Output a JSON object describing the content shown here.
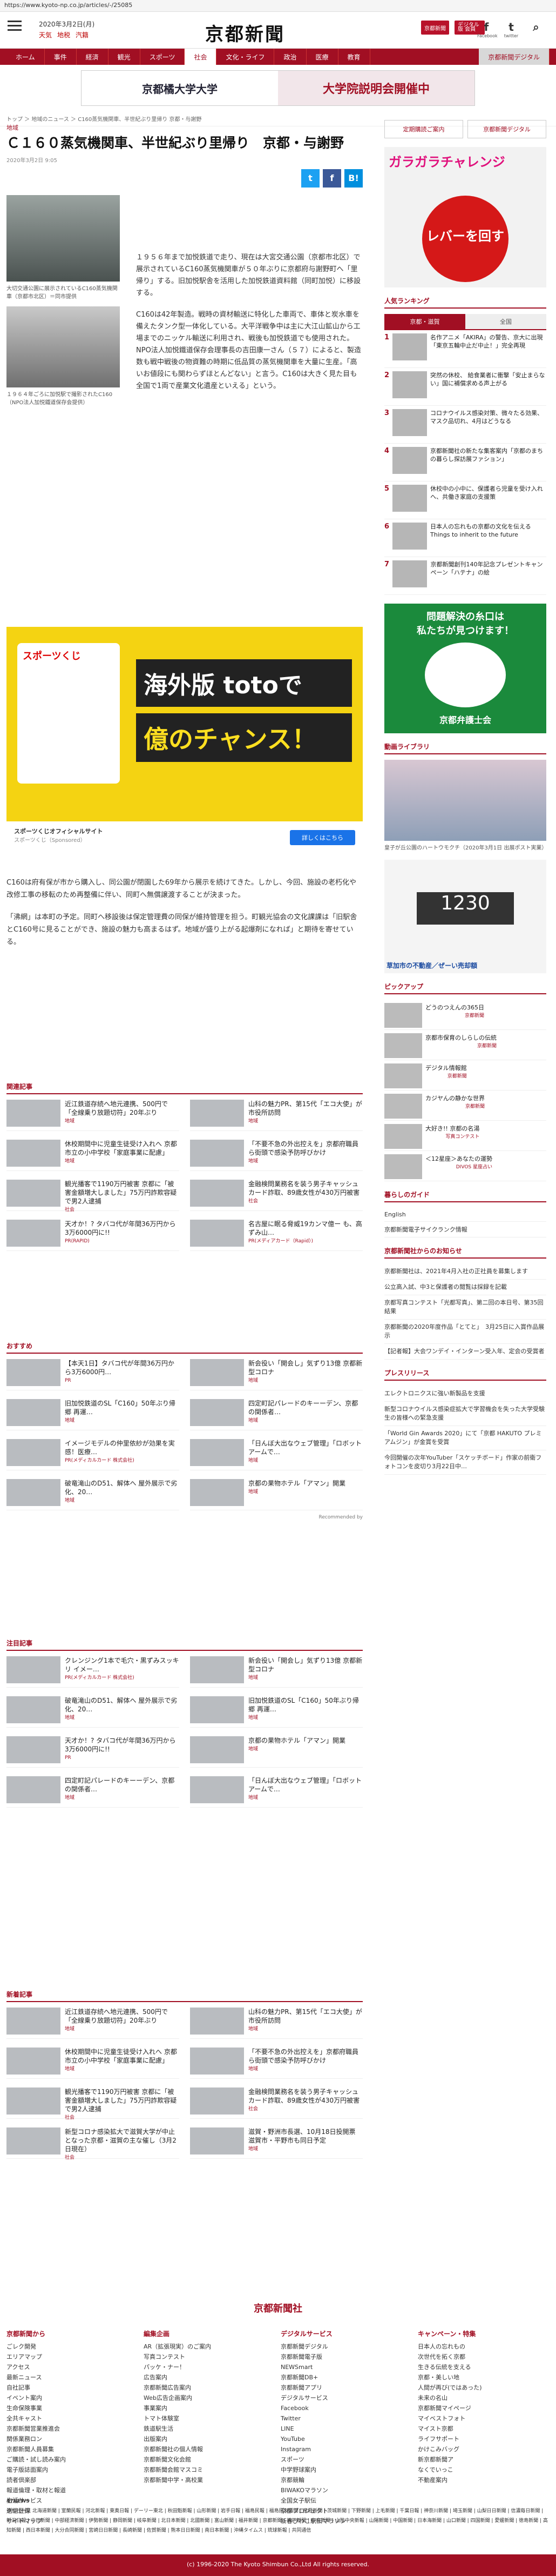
{
  "browser": {
    "url": "https://www.kyoto-np.co.jp/articles/-/25085"
  },
  "header": {
    "date": "2020年3月2日(月)",
    "weather": [
      "天気",
      "地税",
      "汽籍"
    ],
    "logo": "京都新聞",
    "btn_member": "京都新聞",
    "btn_digital": "デジタル版 会員",
    "social": [
      "Facebook",
      "twitter",
      "B!"
    ]
  },
  "nav": [
    "ホーム",
    "事件",
    "経済",
    "観光",
    "スポーツ",
    "社会",
    "文化・ライフ",
    "政治",
    "医療",
    "教育",
    "京都新聞デジタル"
  ],
  "banner": {
    "left": "京都橘大学大学",
    "right": "大学院説明会開催中"
  },
  "breadcrumb": "トップ ＞ 地域のニュース ＞ C160蒸気機関車、半世紀ぶり里帰り 京都・与謝野",
  "article": {
    "category": "地域",
    "title": "Ｃ１６０蒸気機関車、半世紀ぶり里帰り　京都・与謝野",
    "date": "2020年3月2日 9:05",
    "caption1": "大切交通公園に展示されているC160蒸気機関車（京都市北区）＝同市提供",
    "caption2": "１９６４年ごろに加悦駅で撮影されたC160（NPO法人加悦鐵道保存会提供）",
    "p1": "１９５６年まで加悦鉄道で走り、現在は大宮交通公園（京都市北区）で展示されているC160蒸気機関車が５０年ぶりに京都府与謝野町へ「里帰り」する。旧加悦駅舎を活用した加悦鉄道資料館（同町加悦）に移設する。",
    "p2": "C160は42年製造。戦時の資材輸送に特化した車両で、車体と炭水車を備えたタンク型一体化している。大平洋戦争中は主に大江山鉱山から工場までのニッケル輸送に利用され、戦後も加悦鉄道でも使用された。NPO法人加悦鐵道保存会理事長の吉田康一さん（５７）によると、製造数も戦中戦後の物資難の時期に低品質の蒸気機関車を大量に生産。「高いお値段にも関わらずほとんどない」と言う。C160は大きく見た目も全国で1両で産業文化遺産といえる」という。",
    "p3": "C160は府有保が市から購入し、同公園が閉園した69年から展示を続けてきた。しかし、今回、施設の老朽化や改修工事の移転のため再整備に伴い、同町へ無償譲渡することが決まった。",
    "p4": "「沸網」は本町の予定。同町へ移設後は保定管理費の同保が維持管理を担う。町観光協会の文化課課は「旧駅舎とC160号に見ることができ、施設の魅力も高まるはず。地域が盛り上がる起爆剤になれば」と期待を寄せている。"
  },
  "ad": {
    "brand": "スポーツくじ",
    "line1": "海外版 totoで",
    "line2": "億のチャンス！",
    "site": "スポーツくじオフィシャルサイト",
    "sponsor": "スポーツくじ（Sponsored）",
    "cta": "詳しくはこちら"
  },
  "related": {
    "title": "関連記事",
    "items": [
      {
        "t": "近江鉄道存続へ地元連携、500円で「全線乗り放題切符」20年ぶり",
        "tag": "地域"
      },
      {
        "t": "山科の魅力PR、第15代「エコ大使」が市役所訪問",
        "tag": "地域"
      },
      {
        "t": "休校期間中に児童生徒受け入れへ 京都市立の小中学校「家庭事業に配慮」",
        "tag": "地域"
      },
      {
        "t": "「不要不急の外出控えを」京都府職員ら街頭で感染予防呼びかけ",
        "tag": "地域"
      },
      {
        "t": "観光播客で1190万円被害 京都に「被害金額増大しました」75万円詐欺容疑で男2人逮捕",
        "tag": "社会"
      },
      {
        "t": "金融検問業務名を装う男子キャッシュカード詐取、89歳女性が430万円被害",
        "tag": "社会"
      },
      {
        "t": "天才か！? タバコ代が年間36万円から3万6000円に!!",
        "tag": "PR(RAPID)"
      },
      {
        "t": "名古屋に眠る脅威19カンマ億ー も、高ずみ山…",
        "tag": "PR(メディアカード（Rapid）)"
      }
    ]
  },
  "recommend": {
    "title": "おすすめ",
    "items": [
      {
        "t": "【本天1日】タバコ代が年間36万円から3万6000円…",
        "tag": "PR"
      },
      {
        "t": "新会役い「開会し」気ずり13億 京都新型コロナ",
        "tag": "地域"
      },
      {
        "t": "旧加悦鉄道のSL「C160」50年ぶり帰郷 再運…",
        "tag": "地域"
      },
      {
        "t": "四定町記パレードのキーーデン、京都の関係者…",
        "tag": "地域"
      },
      {
        "t": "イメージモデルの仲里依紗が効果を実感！医療…",
        "tag": "PR(メディカルカード 株式会社)"
      },
      {
        "t": "「日んぼ大出なウェブ管理」「ロボットアームで…",
        "tag": "地域"
      },
      {
        "t": "破竜滝山のD51、解体へ 屋外展示で劣化、20…",
        "tag": "地域"
      },
      {
        "t": "京都の果物ホテル「アマン」開業",
        "tag": "地域"
      }
    ],
    "footer": "Recommended by"
  },
  "attention": {
    "title": "注目記事",
    "items": [
      {
        "t": "クレンジング1本で毛穴・黒ずみスッキリ イメー…",
        "tag": "PR(メディカルカード 株式会社)"
      },
      {
        "t": "新会役い「開会し」気ずり13億 京都新型コロナ",
        "tag": "地域"
      },
      {
        "t": "破竜滝山のD51、解体へ 屋外展示で劣化、20…",
        "tag": "地域"
      },
      {
        "t": "旧加悦鉄道のSL「C160」50年ぶり帰郷 再運…",
        "tag": "地域"
      },
      {
        "t": "天才か！? タバコ代が年間36万円から3万6000円に!!",
        "tag": "PR"
      },
      {
        "t": "京都の果物ホテル「アマン」開業",
        "tag": "地域"
      },
      {
        "t": "四定町記パレードのキーーデン、京都の関係者…",
        "tag": "地域"
      },
      {
        "t": "「日んぼ大出なウェブ管理」「ロボットアームで…",
        "tag": "地域"
      }
    ]
  },
  "latest": {
    "title": "新着記事",
    "items": [
      {
        "t": "近江鉄道存続へ地元連携、500円で「全線乗り放題切符」20年ぶり",
        "tag": "地域"
      },
      {
        "t": "山科の魅力PR、第15代「エコ大使」が市役所訪問",
        "tag": "地域"
      },
      {
        "t": "休校期間中に児童生徒受け入れへ 京都市立の小中学校「家庭事業に配慮」",
        "tag": "地域"
      },
      {
        "t": "「不要不急の外出控えを」京都府職員ら街頭で感染予防呼びかけ",
        "tag": "地域"
      },
      {
        "t": "観光播客で1190万円被害 京都に「被害金額増大しました」75万円詐欺容疑で男2人逮捕",
        "tag": "社会"
      },
      {
        "t": "金融検問業務名を装う男子キャッシュカード詐取、89歳女性が430万円被害",
        "tag": "社会"
      },
      {
        "t": "新型コロナ感染拡大で滋賀大学が中止となった京都・滋賀の主な催し（3月2日現在）",
        "tag": "社会"
      },
      {
        "t": "滋賀・野洲市長選、10月18日投開票 滋賀市・平野市も同日予定",
        "tag": "地域"
      }
    ]
  },
  "sidebar": {
    "btn_left": "定期購読ご案内",
    "btn_right": "京都新聞デジタル",
    "ad_title": "ガラガラチャレンジ",
    "ad_button": "レバーを回す",
    "rank_title": "人気ランキング",
    "rank_tabs": [
      "京都・滋賀",
      "全国"
    ],
    "ranking": [
      {
        "n": "1",
        "t": "名作アニメ「AKIRA」の警告、京大に出現「東京五輪中止だ中止！」完全再現"
      },
      {
        "n": "2",
        "t": "突然の休校、 給食業者に衝撃「安止まらない」国に補償求める声上がる"
      },
      {
        "n": "3",
        "t": "コロナウイルス感染対策、微々たる効果、マスク品切れ、4月はどうなる"
      },
      {
        "n": "4",
        "t": "京都新聞社の新たな集客案内「京都のまちの暮らし探訪展ファション」"
      },
      {
        "n": "5",
        "t": "休校中の小中に、保護者ら児童を受け入れへ、共働き家庭の支援策"
      },
      {
        "n": "6",
        "t": "日本人の忘れもの京都の文化を伝える Things to inherit to the future"
      },
      {
        "n": "7",
        "t": "京都新聞創刊140年記念プレゼントキャンペーン「ハテナ」の絵"
      }
    ],
    "green_ad_a": "問題解決の糸口は",
    "green_ad_a2": "私たちが見つけます！",
    "green_ad_b": "京都弁護士会",
    "video_title": "動画ライブラリ",
    "video_caption": "皇子が丘公園のハートウモクチ（2020年3月1日 出展ポスト実業）",
    "house_ad": "草加市の不動産／ぜーい売却額",
    "pickup_title": "ピックアップ",
    "pickup": [
      "どうのつえんの365日",
      "京都市保育のしらしの伝統",
      "デジタル情報館",
      "カジヤんの静かな世界",
      "大好き!! 京都の名湯",
      "＜12星座＞あなたの運勢"
    ],
    "pickup_tags": [
      "京都新聞",
      "京都新聞",
      "京都新聞",
      "京都新聞",
      "写真コンテスト",
      "DIVOS 星座占い"
    ],
    "life_title": "暮らしのガイド",
    "life": [
      "English",
      "京都新聞電子サイクランク情報"
    ],
    "notice_title": "京都新聞社からのお知らせ",
    "notices": [
      "京都新聞社は、2021年4月入社の正社員を募集します",
      "公立高入試、中3と保護者の閲覧は採録を記載",
      "京都写真コンテスト「光都写真」、第二回の本日号、第35回結果",
      "京都新聞の2020年度作品「とてと」　3月25日に入賞作品展示",
      "【記者報】大会ワンデイ・インターン受入年、定会の受賞者"
    ],
    "press_title": "プレスリリース",
    "press": [
      "エレクトロニクスに強い新製品を支援",
      "新型コロナウイルス感染症拡大で学習機会を失った大学受験生の皆様への緊急支援",
      "「World Gin Awards 2020」にて「京都 HAKUTO プレミアムジン」が金賞を受賞",
      "今回開催の次年YouTuber「スケッチボード」作家の前衛フォトコンを皮切り3月22日中…"
    ]
  },
  "footer": {
    "logo": "京都新聞社",
    "cols": [
      {
        "h": "京都新聞から",
        "items": [
          "ごレク開発",
          "エリアマップ",
          "アクセス",
          "最新ニュース",
          "自社記事",
          "イベント案内",
          "生命保険事業",
          "全共キャスト",
          "京都新聞営業推進会",
          "関係業務ロン",
          "京都新聞人員募集",
          "ご購読・試し読み案内",
          "電子版誌面案内",
          "読者倶楽部",
          "報道倫理・取材と報道",
          "生活サービス",
          "送信登録",
          "サイトマップ"
        ]
      },
      {
        "h": "編集企画",
        "items": [
          "AR（拡張現実）のご案内",
          "写真コンテスト",
          "パッケ・ナー！",
          "広告案内",
          "京都新聞広告案内",
          "Web広告企画案内",
          "事業案内",
          "トマト体験室",
          "鉄道駅生活",
          "出版案内",
          "京都新聞社の個人情報",
          "京都新聞文化会館",
          "京都新聞会館マスコミ",
          "京都新聞中学・高校業"
        ]
      },
      {
        "h": "デジタルサービス",
        "items": [
          "京都新聞デジタル",
          "京都新聞電子版",
          "NEWSmart",
          "京都新聞DB+",
          "京都新聞アプリ",
          "デジタルサービス",
          "Facebook",
          "Twitter",
          "LINE",
          "YouTube",
          "Instagram",
          "スポーツ",
          "中学野球案内",
          "京都競輪",
          "BIWAKOマラソン",
          "全国女子駅伝",
          "京都プロジェクト",
          "新春ぴわこ駅伝マラソン"
        ]
      },
      {
        "h": "キャンペーン・特集",
        "items": [
          "日本人の忘れもの",
          "次世代を拓く京都",
          "生きる伝統を支える",
          "京都・美しい地",
          "人間が再び(ではあった)",
          "未来の名山",
          "京都新聞マイページ",
          "マイベストフォト",
          "マイスト京都",
          "ライフサポート",
          "かけこみバッグ",
          "新京都新聞ア",
          "なくでいっこ",
          "不動産案内"
        ]
      }
    ],
    "news47_label": "47NEWS",
    "news47": "参加社一覧 北海道新聞 | 室蘭民報 | 河北新報 | 東奥日報 | デーリー東北 | 秋田魁新報 | 山形新聞 | 岩手日報 | 福島民報 | 福島民友新聞 | 産経新聞 | 茨城新聞 | 下野新聞 | 上毛新聞 | 千葉日報 | 神奈川新聞 | 埼玉新聞 | 山梨日日新聞 | 信濃毎日新聞 | 新潟日報 | 中日新聞 | 中部経済新聞 | 伊勢新聞 | 静岡新聞 | 岐阜新聞 | 北日本新聞 | 北國新聞 | 富山新聞 | 福井新聞 | 京都新聞 | 神戸新聞 | 奈良新聞 | 山陰中央新報 | 山陽新聞 | 中国新聞 | 日本海新聞 | 山口新聞 | 四国新聞 | 愛媛新聞 | 徳島新聞 | 高知新聞 | 西日本新聞 | 大分合同新聞 | 宮崎日日新聞 | 長崎新聞 | 佐賀新聞 | 熊本日日新聞 | 南日本新聞 | 沖縄タイムス | 琉球新報 | 共同通信",
    "copyright": "(c) 1996-2020 The Kyoto Shimbun Co.,Ltd All rights reserved."
  },
  "colors": {
    "brand": "#a10f23",
    "twitter": "#1da1f2",
    "facebook": "#3b5998",
    "hatena": "#008fde"
  }
}
